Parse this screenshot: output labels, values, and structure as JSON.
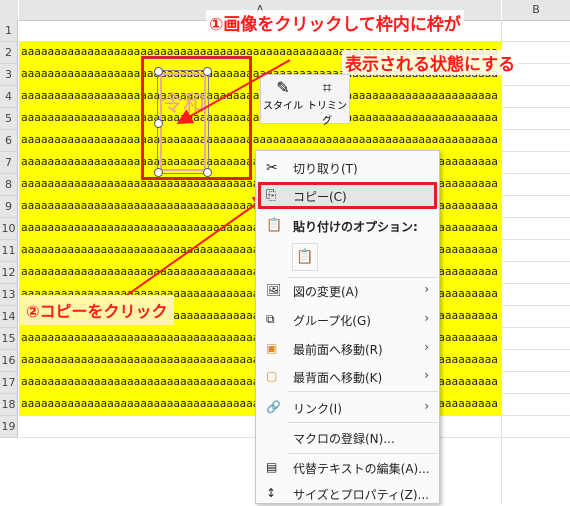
{
  "columns": {
    "a": "A",
    "b": "B"
  },
  "rows": [
    "1",
    "2",
    "3",
    "4",
    "5",
    "6",
    "7",
    "8",
    "9",
    "10",
    "11",
    "12",
    "13",
    "14",
    "15",
    "16",
    "17",
    "18",
    "19"
  ],
  "cell_text": "aaaaaaaaaaaaaaaaaaaaaaaaaaaaaaaaaaaaaaaaaaaaaaaaaaaaaaaaaaaaaaaaaaaaaaaa",
  "callout1": {
    "line1": "①画像をクリックして枠内に枠が",
    "line2": "表示される状態にする"
  },
  "callout2": "②コピーをクリック",
  "ribbon": {
    "style": "スタイル",
    "trim": "トリミング"
  },
  "stamp_text": "令和",
  "menu": {
    "cut": "切り取り(T)",
    "copy": "コピー(C)",
    "paste_options": "貼り付けのオプション:",
    "change_picture": "図の変更(A)",
    "group": "グループ化(G)",
    "bring_front": "最前面へ移動(R)",
    "send_back": "最背面へ移動(K)",
    "link": "リンク(I)",
    "macro": "マクロの登録(N)...",
    "alt_text": "代替テキストの編集(A)...",
    "size_props": "サイズとプロパティ(Z)..."
  },
  "colors": {
    "highlight": "#ffff00",
    "accent_red": "#e02020",
    "callout_red": "#ff1a1a"
  }
}
